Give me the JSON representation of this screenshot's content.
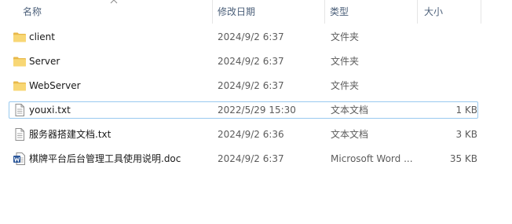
{
  "columns": {
    "name": "名称",
    "date": "修改日期",
    "type": "类型",
    "size": "大小"
  },
  "sort": {
    "column": "name",
    "direction": "ascending",
    "icon": "sort-up-chevron-icon"
  },
  "files": [
    {
      "name": "client",
      "date": "2024/9/2 6:37",
      "type": "文件夹",
      "size": "",
      "icon": "folder-icon"
    },
    {
      "name": "Server",
      "date": "2024/9/2 6:37",
      "type": "文件夹",
      "size": "",
      "icon": "folder-icon"
    },
    {
      "name": "WebServer",
      "date": "2024/9/2 6:37",
      "type": "文件夹",
      "size": "",
      "icon": "folder-icon"
    },
    {
      "name": "youxi.txt",
      "date": "2022/5/29 15:30",
      "type": "文本文档",
      "size": "1 KB",
      "icon": "text-file-icon",
      "focused": true
    },
    {
      "name": "服务器搭建文档.txt",
      "date": "2024/9/2 6:36",
      "type": "文本文档",
      "size": "3 KB",
      "icon": "text-file-icon"
    },
    {
      "name": "棋牌平台后台管理工具使用说明.doc",
      "date": "2024/9/2 6:37",
      "type": "Microsoft Word ...",
      "size": "35 KB",
      "icon": "word-doc-icon"
    }
  ],
  "colors": {
    "folder": "#f8d775",
    "folder_dark": "#e8b84a",
    "focus_border": "#99c9ef",
    "word_blue": "#2b579a"
  }
}
